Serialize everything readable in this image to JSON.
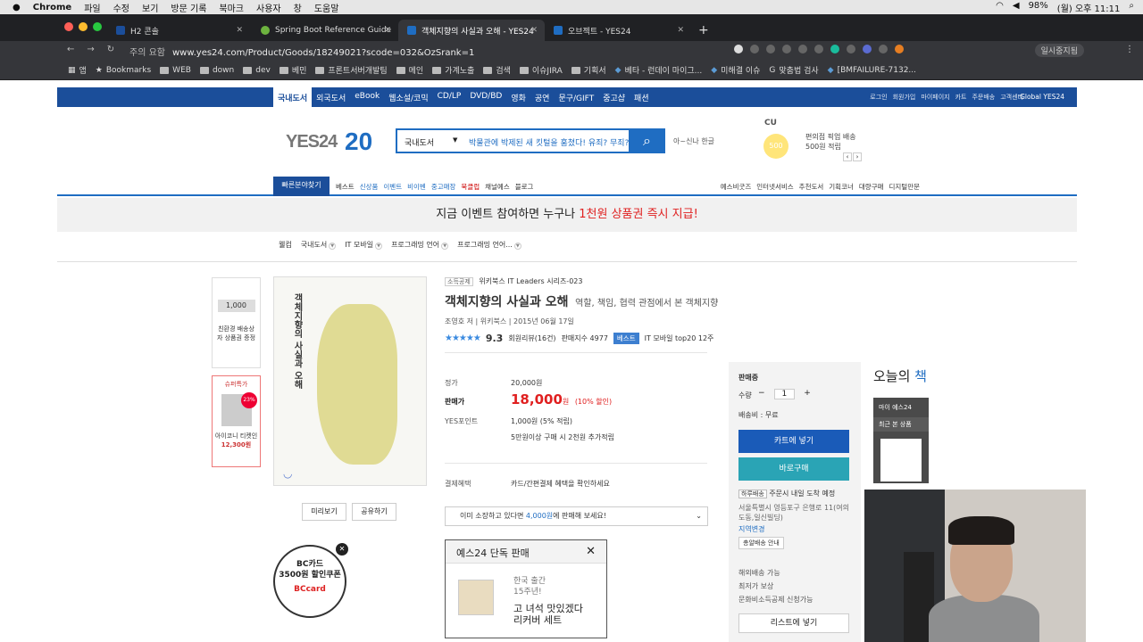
{
  "menubar": {
    "app": "Chrome",
    "items": [
      "파일",
      "수정",
      "보기",
      "방문 기록",
      "북마크",
      "사용자",
      "창",
      "도움말"
    ],
    "battery": "98%",
    "datetime": "(월) 오후 11:11"
  },
  "tabs": [
    {
      "label": "H2 콘솔",
      "active": false
    },
    {
      "label": "Spring Boot Reference Guide",
      "active": false
    },
    {
      "label": "객체지향의 사실과 오해 - YES24",
      "active": true
    },
    {
      "label": "오브젝트 - YES24",
      "active": false
    }
  ],
  "address": {
    "security": "주의 요함",
    "url": "www.yes24.com/Product/Goods/18249021?scode=032&OzSrank=1",
    "pause_label": "일시중지됨"
  },
  "bookmarks": [
    "앱",
    "Bookmarks",
    "WEB",
    "down",
    "dev",
    "베민",
    "프론트서버개발팀",
    "메인",
    "가계노출",
    "검색",
    "이슈JIRA",
    "기획서",
    "베타 - 런데이 마이그...",
    "미해결 이슈",
    "맞춤법 검사",
    "[BMFAILURE-7132..."
  ],
  "site": {
    "topnav": [
      "국내도서",
      "외국도서",
      "eBook",
      "웹소설/코믹",
      "CD/LP",
      "DVD/BD",
      "영화",
      "공연",
      "문구/GIFT",
      "중고샵",
      "패션"
    ],
    "util": [
      "로그인",
      "회원가입",
      "마이페이지",
      "카트",
      "주문배송",
      "고객센터"
    ],
    "global": "Global YES24",
    "logo": "YES24",
    "logo_num": "20",
    "search_cat": "국내도서",
    "search_placeholder": "박물관에 박제된 새 킷털을 훔쳤다! 유죄? 무죄?",
    "search_icon": "search-icon",
    "reco": "아~신나 한글",
    "cu": "CU",
    "coin": "500",
    "conv_line1": "편의점 픽업 배송",
    "conv_line2": "500원 적립",
    "quick": "빠른분야찾기",
    "catnav": [
      "베스트",
      "신상품",
      "이벤트",
      "비이벤",
      "중고매장",
      "북클럽",
      "채널예스",
      "블로그"
    ],
    "catnav_right": [
      "예스비굿즈",
      "인터넷서비스",
      "추천도서",
      "기획코너",
      "대량구매",
      "디지털만문"
    ],
    "banner_pre": "지금 이벤트 참여하면 누구나 ",
    "banner_hl": "1천원 상품권 즉시 지급!",
    "crumbs": [
      "웰컴",
      "국내도서",
      "IT 모바일",
      "프로그래밍 언어",
      "프로그래밍 언어..."
    ]
  },
  "left": {
    "thumb1_price": "1,000",
    "thumb1_caption": "친환경 배송상자 상품권 증정",
    "thumb2_head": "슈퍼특가",
    "thumb2_pct": "23%",
    "thumb2_caption": "아이코니 티켓인",
    "thumb2_price": "12,300원",
    "cover_title": "객체지향의 사실과 오해",
    "preview": "미리보기",
    "share": "공유하기",
    "bc_line1": "BC카드",
    "bc_line2": "3500원 할인쿠폰",
    "bc_brand": "BCcard"
  },
  "product": {
    "tag1": "소득공제",
    "series": "위키북스 IT Leaders 시리즈-023",
    "title": "객체지향의 사실과 오해",
    "subtitle": "역할, 책임, 협력 관점에서 본 객체지향",
    "author": "조영호 저",
    "publisher": "위키북스",
    "date": "2015년 06월 17일",
    "stars": "★★★★★",
    "rating": "9.3",
    "reviews": "회원리뷰(16건)",
    "sales": "판매지수 4977",
    "best": "베스트",
    "rank": "IT 모바일 top20 12주",
    "list_label": "정가",
    "list_price": "20,000원",
    "sale_label": "판매가",
    "sale_price": "18,000",
    "sale_unit": "원",
    "discount": "(10% 할인)",
    "point_label": "YES포인트",
    "point": "1,000원 (5% 적립)",
    "point_extra": "5만원이상 구매 시 2천원 추가적립",
    "benefit_label": "결제혜택",
    "benefit": "카드/간편결제 혜택을 확인하세요",
    "resell_pre": "이미 소장하고 있다면 ",
    "resell_hl": "4,000원",
    "resell_post": "에 판매해 보세요!"
  },
  "popup": {
    "title": "예스24 단독 판매",
    "line1": "한국 출간",
    "line2": "15주년!",
    "line3": "고 녀석 맛있겠다",
    "line4": "리커버 세트"
  },
  "buy": {
    "status": "판매중",
    "qty_label": "수량",
    "qty": "1",
    "ship_label": "배송비 : 무료",
    "cart": "카트에 넣기",
    "buy": "바로구매",
    "delivery_badge": "하루배송",
    "delivery_text": "주문시 내일 도착 예정",
    "addr": "서울특별시 영등포구 은행로 11(여의도동,일신빌딩)",
    "addr_change": "지역변경",
    "guide": "총알배송 안내",
    "opt1": "해외배송 가능",
    "opt2": "최저가 보상",
    "opt3": "문화비소득공제 신청가능",
    "wish": "리스트에 넣기"
  },
  "side": {
    "today_pre": "오늘의 ",
    "today_hl": "책",
    "my": "마이 예스24",
    "recent": "최근 본 상품"
  }
}
